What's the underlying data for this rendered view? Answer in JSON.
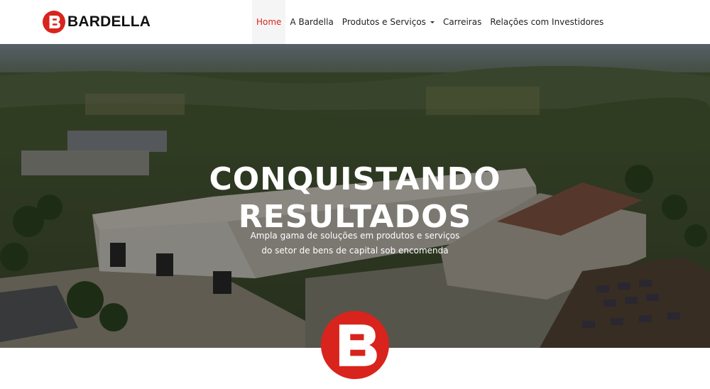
{
  "header": {
    "logo_text": "BARDELLA",
    "logo_icon": "bardella-b-logo-icon",
    "brand_color": "#d8241c",
    "nav": [
      {
        "label": "Home",
        "active": true
      },
      {
        "label": "A Bardella"
      },
      {
        "label": "Produtos e Serviços",
        "dropdown": true
      },
      {
        "label": "Carreiras"
      },
      {
        "label": "Relações com Investidores"
      }
    ]
  },
  "hero": {
    "background": "aerial-photo-bardella-factory",
    "title_line1": "CONQUISTANDO",
    "title_line2": "RESULTADOS",
    "subtitle_line1": "Ampla gama de soluções em produtos e serviços",
    "subtitle_line2": "do setor de bens de capital sob encomenda"
  },
  "badge": {
    "icon": "bardella-b-badge-icon"
  }
}
